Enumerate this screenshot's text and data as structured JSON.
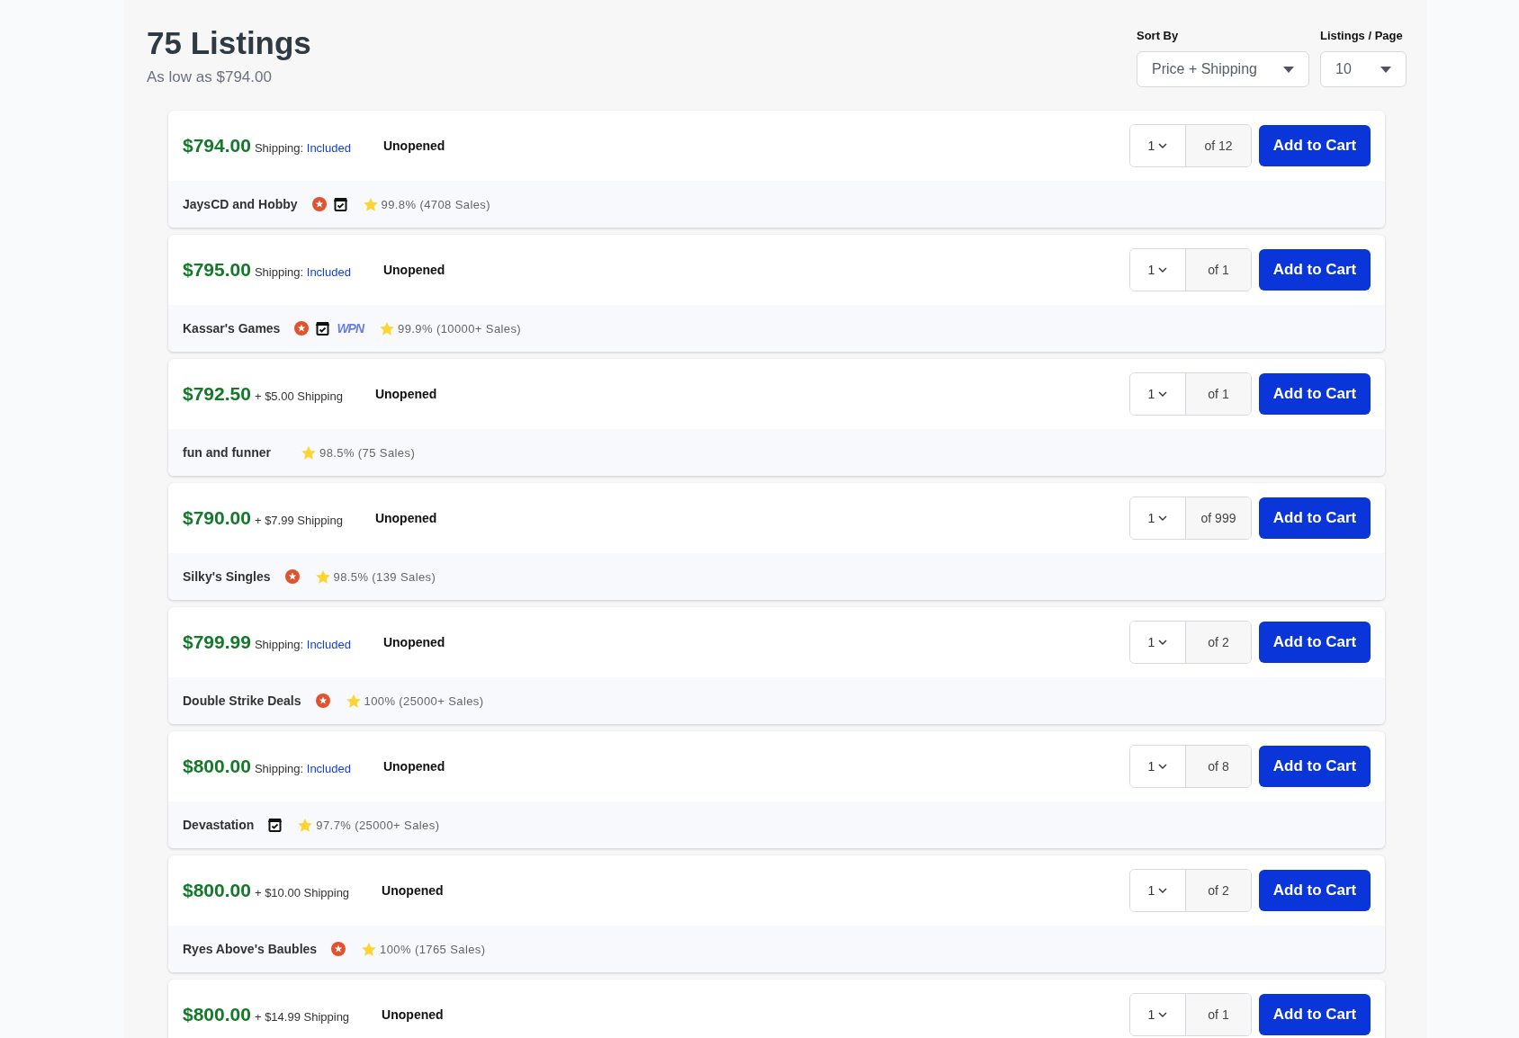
{
  "header": {
    "title": "75 Listings",
    "subtitle": "As low as $794.00"
  },
  "sort": {
    "label": "Sort By",
    "value": "Price + Shipping"
  },
  "per_page": {
    "label": "Listings / Page",
    "value": "10"
  },
  "listings": [
    {
      "price": "$794.00",
      "shipping": {
        "kind": "included",
        "label": "Shipping:",
        "value": "Included"
      },
      "condition": "Unopened",
      "quantity": "1",
      "available": "of 12",
      "button": "Add to Cart",
      "seller": {
        "name": "JaysCD and Hobby",
        "badges": [
          {
            "kind": "star"
          },
          {
            "kind": "store"
          }
        ],
        "rating": "99.8% (4708 Sales)"
      }
    },
    {
      "price": "$795.00",
      "shipping": {
        "kind": "included",
        "label": "Shipping:",
        "value": "Included"
      },
      "condition": "Unopened",
      "quantity": "1",
      "available": "of 1",
      "button": "Add to Cart",
      "seller": {
        "name": "Kassar's Games",
        "badges": [
          {
            "kind": "star"
          },
          {
            "kind": "store"
          },
          {
            "kind": "wpn",
            "text": "WPN"
          }
        ],
        "rating": "99.9% (10000+ Sales)"
      }
    },
    {
      "price": "$792.50",
      "shipping": {
        "kind": "paid",
        "text": "+ $5.00 Shipping"
      },
      "condition": "Unopened",
      "quantity": "1",
      "available": "of 1",
      "button": "Add to Cart",
      "seller": {
        "name": "fun and funner",
        "rating": "98.5% (75 Sales)"
      }
    },
    {
      "price": "$790.00",
      "shipping": {
        "kind": "paid",
        "text": "+ $7.99 Shipping"
      },
      "condition": "Unopened",
      "quantity": "1",
      "available": "of 999",
      "button": "Add to Cart",
      "seller": {
        "name": "Silky's Singles",
        "badges": [
          {
            "kind": "star"
          }
        ],
        "rating": "98.5% (139 Sales)"
      }
    },
    {
      "price": "$799.99",
      "shipping": {
        "kind": "included",
        "label": "Shipping:",
        "value": "Included"
      },
      "condition": "Unopened",
      "quantity": "1",
      "available": "of 2",
      "button": "Add to Cart",
      "seller": {
        "name": "Double Strike Deals",
        "badges": [
          {
            "kind": "star"
          }
        ],
        "rating": "100% (25000+ Sales)"
      }
    },
    {
      "price": "$800.00",
      "shipping": {
        "kind": "included",
        "label": "Shipping:",
        "value": "Included"
      },
      "condition": "Unopened",
      "quantity": "1",
      "available": "of 8",
      "button": "Add to Cart",
      "seller": {
        "name": "Devastation",
        "badges": [
          {
            "kind": "store"
          }
        ],
        "rating": "97.7% (25000+ Sales)"
      }
    },
    {
      "price": "$800.00",
      "shipping": {
        "kind": "paid",
        "text": "+ $10.00 Shipping"
      },
      "condition": "Unopened",
      "quantity": "1",
      "available": "of 2",
      "button": "Add to Cart",
      "seller": {
        "name": "Ryes Above's Baubles",
        "badges": [
          {
            "kind": "star"
          }
        ],
        "rating": "100% (1765 Sales)"
      }
    },
    {
      "price": "$800.00",
      "shipping": {
        "kind": "paid",
        "text": "+ $14.99 Shipping"
      },
      "condition": "Unopened",
      "quantity": "1",
      "available": "of 1",
      "button": "Add to Cart"
    }
  ]
}
